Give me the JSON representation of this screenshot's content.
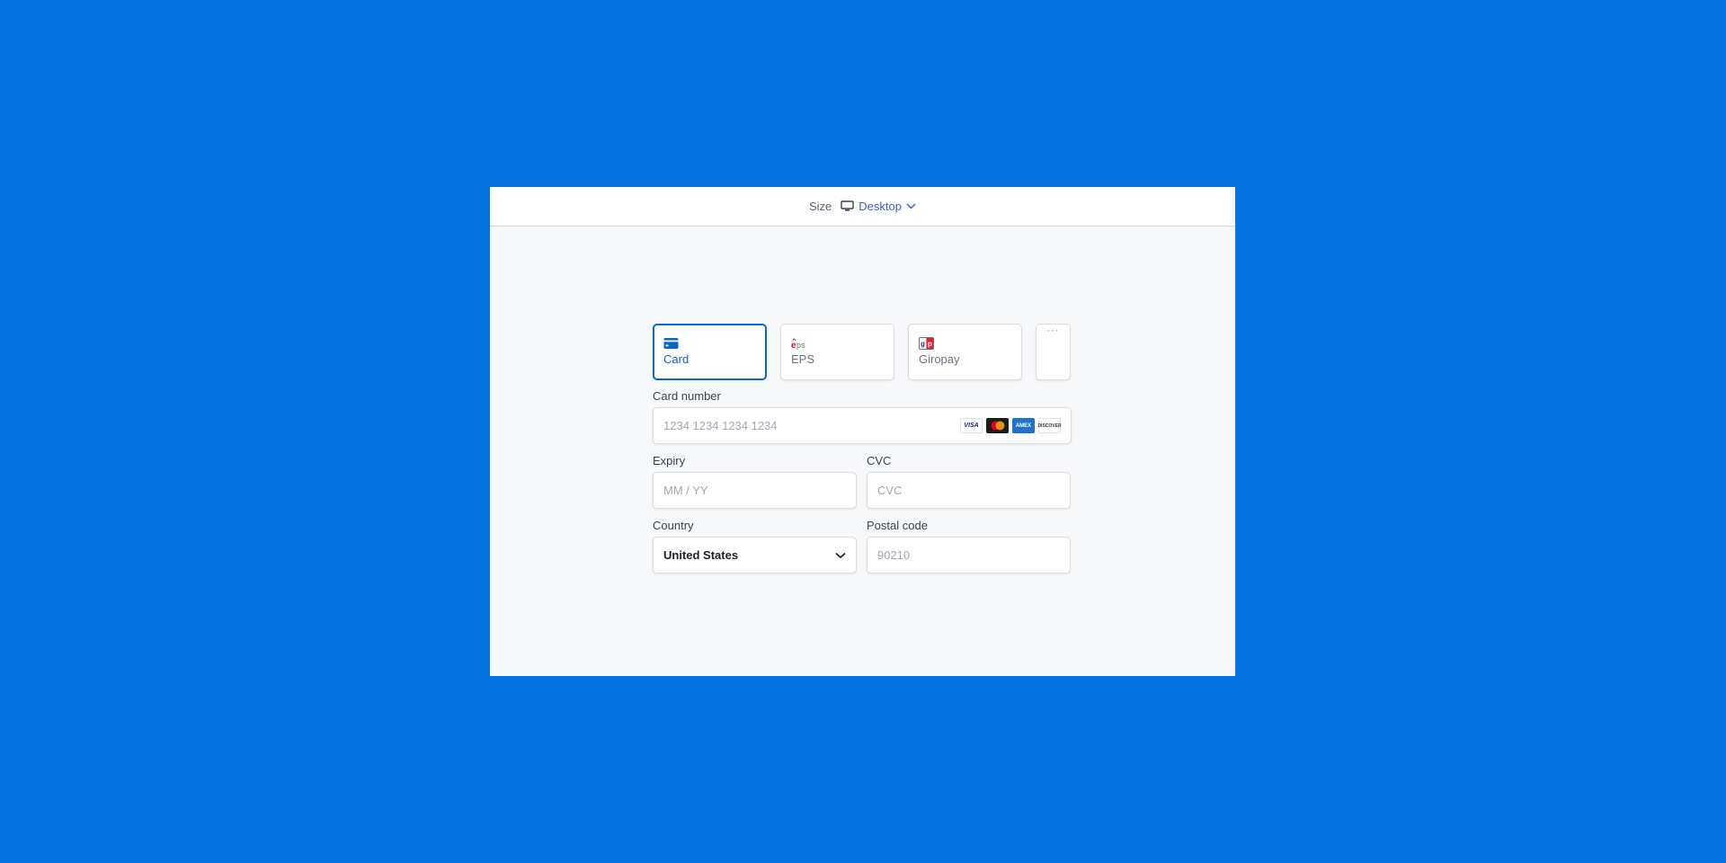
{
  "topbar": {
    "size_label": "Size",
    "size_value": "Desktop",
    "size_icon": "monitor-icon",
    "chevron_icon": "chevron-down-icon"
  },
  "payment_methods": {
    "tabs": [
      {
        "label": "Card",
        "icon": "credit-card-icon",
        "active": true
      },
      {
        "label": "EPS",
        "icon": "eps-logo-icon",
        "active": false
      },
      {
        "label": "Giropay",
        "icon": "giropay-logo-icon",
        "active": false
      }
    ],
    "more_label": "···"
  },
  "card_number": {
    "label": "Card number",
    "placeholder": "1234 1234 1234 1234",
    "brands": [
      "VISA",
      "mastercard",
      "AMEX",
      "DISCOVER"
    ]
  },
  "expiry": {
    "label": "Expiry",
    "placeholder": "MM / YY"
  },
  "cvc": {
    "label": "CVC",
    "placeholder": "CVC"
  },
  "country": {
    "label": "Country",
    "value": "United States"
  },
  "postal_code": {
    "label": "Postal code",
    "placeholder": "90210"
  },
  "colors": {
    "background": "#0573e0",
    "accent": "#0c66c8",
    "link": "#3d5fd4"
  }
}
